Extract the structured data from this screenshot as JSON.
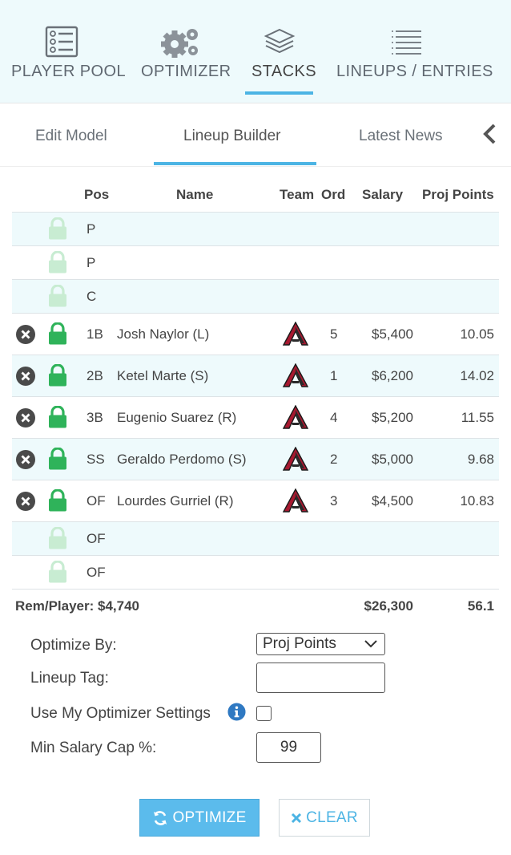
{
  "nav": {
    "items": [
      {
        "label": "PLAYER POOL",
        "icon": "player-list-icon"
      },
      {
        "label": "OPTIMIZER",
        "icon": "gears-icon"
      },
      {
        "label": "STACKS",
        "icon": "layers-icon"
      },
      {
        "label": "LINEUPS / ENTRIES",
        "icon": "numbered-list-icon"
      }
    ],
    "active": "STACKS"
  },
  "subtabs": {
    "items": [
      "Edit Model",
      "Lineup Builder",
      "Latest News"
    ],
    "active": "Lineup Builder"
  },
  "table": {
    "headers": {
      "pos": "Pos",
      "name": "Name",
      "team": "Team",
      "ord": "Ord",
      "salary": "Salary",
      "proj": "Proj Points"
    },
    "rows": [
      {
        "pos": "P",
        "name": "",
        "ord": "",
        "salary": "",
        "proj": "",
        "filled": false
      },
      {
        "pos": "P",
        "name": "",
        "ord": "",
        "salary": "",
        "proj": "",
        "filled": false
      },
      {
        "pos": "C",
        "name": "",
        "ord": "",
        "salary": "",
        "proj": "",
        "filled": false
      },
      {
        "pos": "1B",
        "name": "Josh Naylor (L)",
        "ord": "5",
        "salary": "$5,400",
        "proj": "10.05",
        "filled": true
      },
      {
        "pos": "2B",
        "name": "Ketel Marte (S)",
        "ord": "1",
        "salary": "$6,200",
        "proj": "14.02",
        "filled": true
      },
      {
        "pos": "3B",
        "name": "Eugenio Suarez (R)",
        "ord": "4",
        "salary": "$5,200",
        "proj": "11.55",
        "filled": true
      },
      {
        "pos": "SS",
        "name": "Geraldo Perdomo (S)",
        "ord": "2",
        "salary": "$5,000",
        "proj": "9.68",
        "filled": true
      },
      {
        "pos": "OF",
        "name": "Lourdes Gurriel (R)",
        "ord": "3",
        "salary": "$4,500",
        "proj": "10.83",
        "filled": true
      },
      {
        "pos": "OF",
        "name": "",
        "ord": "",
        "salary": "",
        "proj": "",
        "filled": false
      },
      {
        "pos": "OF",
        "name": "",
        "ord": "",
        "salary": "",
        "proj": "",
        "filled": false
      }
    ],
    "footer": {
      "rem_player": "Rem/Player: $4,740",
      "total_salary": "$26,300",
      "total_proj": "56.1"
    }
  },
  "form": {
    "optimize_by_label": "Optimize By:",
    "optimize_by_value": "Proj Points",
    "lineup_tag_label": "Lineup Tag:",
    "lineup_tag_value": "",
    "use_settings_label": "Use My Optimizer Settings",
    "use_settings_checked": false,
    "min_salary_label": "Min Salary Cap %:",
    "min_salary_value": "99"
  },
  "buttons": {
    "optimize": "OPTIMIZE",
    "clear": "CLEAR"
  },
  "colors": {
    "accent": "#4cb4e4",
    "lock_active": "#2fb35a",
    "lock_inactive": "#c8ecd2",
    "remove": "#4a4a4a",
    "info": "#2f79c2",
    "team_red": "#a71930",
    "row_alt": "#eefafc"
  }
}
